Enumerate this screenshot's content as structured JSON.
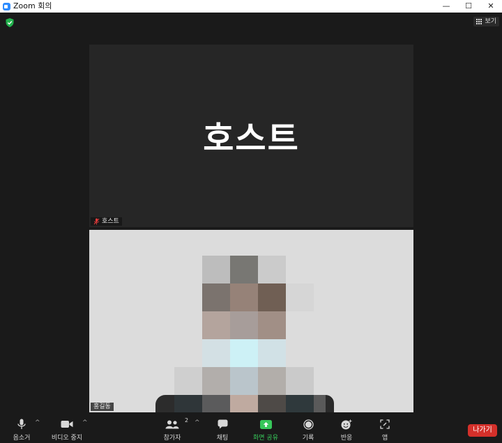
{
  "window": {
    "title": "Zoom 회의",
    "controls": {
      "minimize": "—",
      "maximize": "☐",
      "close": "✕"
    }
  },
  "meeting": {
    "view_button_label": "보기",
    "host_tile": {
      "display_name": "호스트",
      "name_tag": "호스트"
    },
    "user_tile": {
      "name_tag": "홍길동"
    }
  },
  "toolbar": {
    "mute_label": "음소거",
    "video_label": "비디오 중지",
    "participants_label": "참가자",
    "participants_count": "2",
    "chat_label": "채팅",
    "share_label": "화면 공유",
    "record_label": "기록",
    "reactions_label": "반응",
    "apps_label": "앱",
    "leave_label": "나가기",
    "caret": "^"
  },
  "colors": {
    "accent_green": "#37c75a",
    "leave_red": "#d4302a",
    "zoom_blue": "#2d8cff"
  }
}
